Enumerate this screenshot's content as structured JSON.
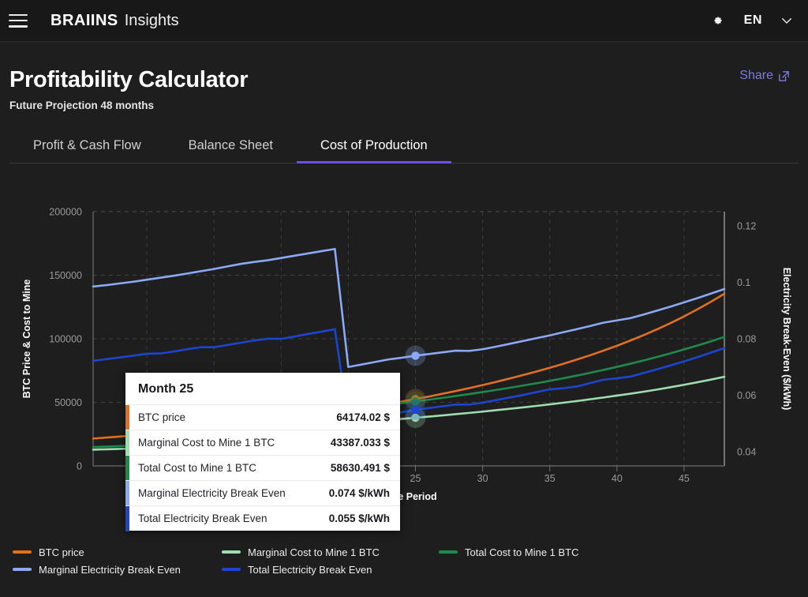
{
  "header": {
    "menu_icon": "hamburger-icon",
    "brand_mark": "BRAIINS",
    "brand_sub": "Insights",
    "settings_icon": "gear-icon",
    "language": "EN",
    "chevron_icon": "chevron-down-icon"
  },
  "page": {
    "title": "Profitability Calculator",
    "subtitle": "Future Projection 48 months",
    "share_label": "Share",
    "share_icon": "share-external-icon"
  },
  "tabs": [
    {
      "label": "Profit & Cash Flow",
      "active": false
    },
    {
      "label": "Balance Sheet",
      "active": false
    },
    {
      "label": "Cost of Production",
      "active": true
    }
  ],
  "colors": {
    "accent_purple": "#6c4ee8",
    "share_purple": "#7a7ae8",
    "btc_price": "#e2701f",
    "marginal_cost": "#9fdcb0",
    "total_cost": "#1f8a4c",
    "marginal_elec": "#8aaaf5",
    "total_elec": "#1c46d2",
    "background": "#1e1e1e",
    "topbar": "#181818"
  },
  "tooltip": {
    "title": "Month 25",
    "rows": [
      {
        "color": "#e2701f",
        "name": "BTC price",
        "value": "64174.02 $"
      },
      {
        "color": "#9fdcb0",
        "name": "Marginal Cost to Mine 1 BTC",
        "value": "43387.033 $"
      },
      {
        "color": "#1f8a4c",
        "name": "Total Cost to Mine 1 BTC",
        "value": "58630.491 $"
      },
      {
        "color": "#8aaaf5",
        "name": "Marginal Electricity Break Even",
        "value": "0.074 $/kWh"
      },
      {
        "color": "#1c46d2",
        "name": "Total Electricity Break Even",
        "value": "0.055 $/kWh"
      }
    ]
  },
  "legend": [
    {
      "label": "BTC price",
      "color": "#e2701f"
    },
    {
      "label": "Marginal Cost to Mine 1 BTC",
      "color": "#9fdcb0"
    },
    {
      "label": "Total Cost to Mine 1 BTC",
      "color": "#1f8a4c"
    },
    {
      "label": "Marginal Electricity Break Even",
      "color": "#8aaaf5"
    },
    {
      "label": "Total Electricity Break Even",
      "color": "#1c46d2"
    }
  ],
  "chart_data": {
    "type": "line",
    "title": "",
    "xlabel": "Time Period",
    "ylabel": "BTC Price & Cost to Mine",
    "y2label": "Electricity Break-Even ($/kWh)",
    "grid": true,
    "legend_position": "bottom-left",
    "xlim": [
      1,
      48
    ],
    "ylim": [
      0,
      200000
    ],
    "y2lim": [
      0.035,
      0.125
    ],
    "xticks": [
      5,
      10,
      15,
      20,
      25,
      30,
      35,
      40,
      45
    ],
    "yticks": [
      0,
      50000,
      100000,
      150000,
      200000
    ],
    "y2ticks": [
      0.04,
      0.06,
      0.08,
      0.1,
      0.12
    ],
    "hover_x": 25,
    "x": [
      1,
      2,
      3,
      4,
      5,
      6,
      7,
      8,
      9,
      10,
      11,
      12,
      13,
      14,
      15,
      16,
      17,
      18,
      19,
      20,
      21,
      22,
      23,
      24,
      25,
      26,
      27,
      28,
      29,
      30,
      31,
      32,
      33,
      34,
      35,
      36,
      37,
      38,
      39,
      40,
      41,
      42,
      43,
      44,
      45,
      46,
      47,
      48
    ],
    "series": [
      {
        "name": "BTC price",
        "color": "#e2701f",
        "axis": "left",
        "values": [
          21500,
          22300,
          23100,
          24000,
          24900,
          25800,
          26800,
          27800,
          28900,
          30000,
          31100,
          32300,
          33500,
          34800,
          36100,
          37500,
          38900,
          40400,
          42000,
          43600,
          45300,
          47000,
          48800,
          50700,
          52600,
          54600,
          56700,
          58900,
          61200,
          63600,
          66100,
          68700,
          71400,
          74200,
          77200,
          80300,
          83600,
          87000,
          90700,
          94500,
          98600,
          102900,
          107500,
          112400,
          117600,
          123200,
          129100,
          135400
        ]
      },
      {
        "name": "Marginal Cost to Mine 1 BTC",
        "color": "#9fdcb0",
        "axis": "left",
        "values": [
          12800,
          13100,
          13400,
          13700,
          14000,
          14400,
          14800,
          15200,
          15600,
          16000,
          16400,
          16900,
          17400,
          17900,
          18400,
          18900,
          19500,
          20100,
          20700,
          33800,
          34600,
          35400,
          36200,
          37000,
          37900,
          38800,
          39700,
          40700,
          41700,
          42700,
          43800,
          44900,
          46000,
          47200,
          48400,
          49700,
          51000,
          52400,
          53800,
          55300,
          56800,
          58400,
          60100,
          61900,
          63800,
          65800,
          67900,
          70100
        ]
      },
      {
        "name": "Total Cost to Mine 1 BTC",
        "color": "#1f8a4c",
        "axis": "left",
        "values": [
          14800,
          15200,
          15600,
          16000,
          16500,
          17000,
          17500,
          18000,
          18600,
          19200,
          19800,
          20400,
          21100,
          21800,
          22500,
          23200,
          24000,
          24800,
          25600,
          44500,
          45700,
          46900,
          48100,
          49400,
          50700,
          52100,
          53500,
          55000,
          56500,
          58100,
          59700,
          61400,
          63200,
          65000,
          66900,
          68900,
          71000,
          73200,
          75500,
          77900,
          80400,
          83000,
          85700,
          88600,
          91600,
          94700,
          98000,
          101500
        ]
      },
      {
        "name": "Marginal Electricity Break Even",
        "color": "#8aaaf5",
        "axis": "right",
        "values": [
          0.0985,
          0.099,
          0.0996,
          0.1002,
          0.1009,
          0.1016,
          0.1023,
          0.1031,
          0.1039,
          0.1047,
          0.1056,
          0.1065,
          0.1072,
          0.1078,
          0.1086,
          0.1094,
          0.1102,
          0.111,
          0.1118,
          0.07,
          0.0709,
          0.0718,
          0.0727,
          0.0733,
          0.074,
          0.0746,
          0.0752,
          0.0758,
          0.0757,
          0.0763,
          0.0772,
          0.0782,
          0.0792,
          0.0802,
          0.0812,
          0.0823,
          0.0834,
          0.0845,
          0.0857,
          0.0865,
          0.0873,
          0.0886,
          0.09,
          0.0914,
          0.0929,
          0.0944,
          0.096,
          0.0976
        ]
      },
      {
        "name": "Total Electricity Break Even",
        "color": "#1c46d2",
        "axis": "right",
        "values": [
          0.0722,
          0.0728,
          0.0734,
          0.074,
          0.0747,
          0.0748,
          0.0755,
          0.0763,
          0.077,
          0.077,
          0.0778,
          0.0786,
          0.0794,
          0.08,
          0.08,
          0.0808,
          0.0817,
          0.0825,
          0.0834,
          0.0508,
          0.0516,
          0.0524,
          0.0532,
          0.054,
          0.0549,
          0.0555,
          0.0561,
          0.0567,
          0.0567,
          0.0574,
          0.0583,
          0.0592,
          0.0601,
          0.0611,
          0.0621,
          0.0625,
          0.0631,
          0.0643,
          0.0655,
          0.066,
          0.0666,
          0.0679,
          0.0692,
          0.0706,
          0.072,
          0.0735,
          0.0751,
          0.0767
        ]
      }
    ]
  }
}
